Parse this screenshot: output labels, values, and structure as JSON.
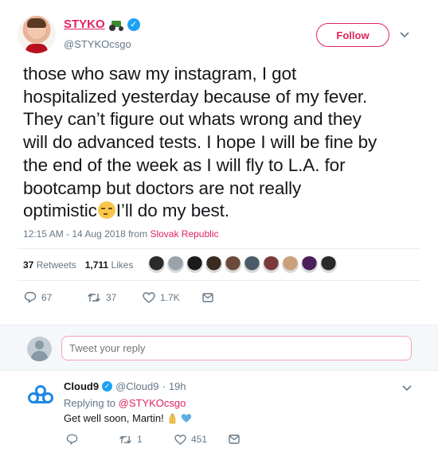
{
  "tweet": {
    "display_name": "STYKO",
    "handle": "@STYKOcsgo",
    "follow_label": "Follow",
    "text_lines": [
      "those who saw my instagram, I got",
      "hospitalized yesterday because of my fever.",
      "They can’t figure out whats wrong and they",
      "will do advanced tests. I hope I will be fine by",
      "the end of the week as I will fly to L.A. for",
      "bootcamp but doctors are not really",
      "optimistic",
      "I’ll do my best."
    ],
    "timestamp": "12:15 AM - 14 Aug 2018 from ",
    "location": "Slovak Republic",
    "stats": {
      "retweets_count": "37",
      "retweets_label": "Retweets",
      "likes_count": "1,711",
      "likes_label": "Likes"
    },
    "actions": {
      "replies": "67",
      "retweets": "37",
      "likes": "1.7K"
    }
  },
  "liker_colors": [
    "#2b2b2b",
    "#98a3ad",
    "#1b1b1b",
    "#3a2a22",
    "#6b4a3a",
    "#4b5b6a",
    "#7a3a3a",
    "#c9a07a",
    "#4a1f5a",
    "#2a2a2a"
  ],
  "composer": {
    "placeholder": "Tweet your reply"
  },
  "reply": {
    "name": "Cloud9",
    "handle": "@Cloud9",
    "time": "19h",
    "replying_prefix": "Replying to ",
    "replying_to": "@STYKOcsgo",
    "text": "Get well soon, Martin!",
    "actions": {
      "retweets": "1",
      "likes": "451"
    }
  },
  "colors": {
    "accent": "#e0245e",
    "verified": "#1da1f2",
    "muted": "#657786",
    "cloud9": "#1e88e5"
  }
}
